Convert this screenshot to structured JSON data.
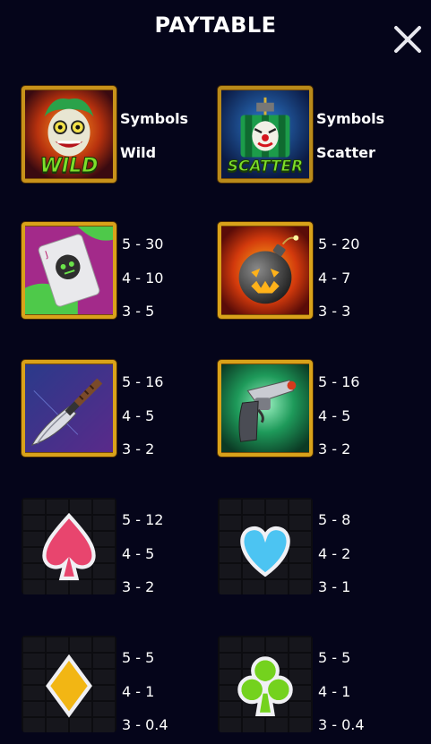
{
  "header": {
    "title": "PAYTABLE",
    "close_icon": "close-icon"
  },
  "special": [
    {
      "id": "wild",
      "icon": "joker-wild-icon",
      "line1": "Symbols",
      "line2": "Wild",
      "badge": "WILD"
    },
    {
      "id": "scatter",
      "icon": "clown-bomb-scatter-icon",
      "line1": "Symbols",
      "line2": "Scatter",
      "badge": "SCATTER"
    }
  ],
  "symbols": [
    {
      "id": "card",
      "icon": "joker-card-icon",
      "pays": [
        "5 - 30",
        "4 - 10",
        "3 - 5"
      ]
    },
    {
      "id": "bomb",
      "icon": "bomb-icon",
      "pays": [
        "5 - 20",
        "4 - 7",
        "3 - 3"
      ]
    },
    {
      "id": "knife",
      "icon": "knife-icon",
      "pays": [
        "5 - 16",
        "4 - 5",
        "3 - 2"
      ]
    },
    {
      "id": "gun",
      "icon": "gun-icon",
      "pays": [
        "5 - 16",
        "4 - 5",
        "3 - 2"
      ]
    },
    {
      "id": "spade",
      "icon": "spade-icon",
      "pays": [
        "5 - 12",
        "4 - 5",
        "3 - 2"
      ]
    },
    {
      "id": "heart",
      "icon": "heart-icon",
      "pays": [
        "5 - 8",
        "4 - 2",
        "3 - 1"
      ]
    },
    {
      "id": "diamond",
      "icon": "diamond-icon",
      "pays": [
        "5 - 5",
        "4 - 1",
        "3 - 0.4"
      ]
    },
    {
      "id": "club",
      "icon": "club-icon",
      "pays": [
        "5 - 5",
        "4 - 1",
        "3 - 0.4"
      ]
    }
  ],
  "colors": {
    "background": "#05051a",
    "frame_gold": "#d9a21a",
    "text": "#ffffff"
  }
}
